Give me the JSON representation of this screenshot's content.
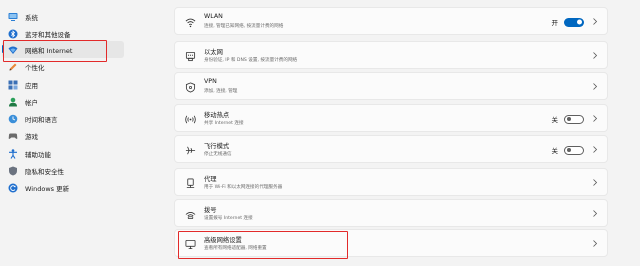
{
  "sidebar": {
    "items": [
      {
        "label": "系统",
        "icon": "monitor-icon"
      },
      {
        "label": "蓝牙和其他设备",
        "icon": "bluetooth-icon"
      },
      {
        "label": "网络和 Internet",
        "icon": "wifi-shield-icon",
        "active": true
      },
      {
        "label": "个性化",
        "icon": "pen-icon"
      },
      {
        "label": "应用",
        "icon": "apps-icon"
      },
      {
        "label": "帐户",
        "icon": "person-icon"
      },
      {
        "label": "时间和语言",
        "icon": "globe-clock-icon"
      },
      {
        "label": "游戏",
        "icon": "gamepad-icon"
      },
      {
        "label": "辅助功能",
        "icon": "accessibility-icon"
      },
      {
        "label": "隐私和安全性",
        "icon": "shield-icon"
      },
      {
        "label": "Windows 更新",
        "icon": "update-icon"
      }
    ]
  },
  "settings": [
    {
      "title": "WLAN",
      "subtitle": "连接, 管理已知网络, 按流量计费的网络",
      "icon": "wifi-icon",
      "toggle": true,
      "toggle_state": "开"
    },
    {
      "title": "以太网",
      "subtitle": "身份验证, IP 和 DNS 设置, 按流量计费的网络",
      "icon": "ethernet-icon"
    },
    {
      "title": "VPN",
      "subtitle": "添加, 连接, 管理",
      "icon": "vpn-shield-icon"
    },
    {
      "title": "移动热点",
      "subtitle": "共享 Internet 连接",
      "icon": "hotspot-icon",
      "toggle": false,
      "toggle_state": "关"
    },
    {
      "title": "飞行模式",
      "subtitle": "停止无线通信",
      "icon": "airplane-icon",
      "toggle": false,
      "toggle_state": "关"
    },
    {
      "title": "代理",
      "subtitle": "用于 Wi-Fi 和以太网连接的代理服务器",
      "icon": "proxy-icon"
    },
    {
      "title": "拨号",
      "subtitle": "设置拨号 Internet 连接",
      "icon": "dialup-icon"
    },
    {
      "title": "高级网络设置",
      "subtitle": "查看所有网络适配器, 网络重置",
      "icon": "network-adapter-icon"
    }
  ],
  "colors": {
    "accent": "#0067c0",
    "highlight": "#e22a2a"
  }
}
